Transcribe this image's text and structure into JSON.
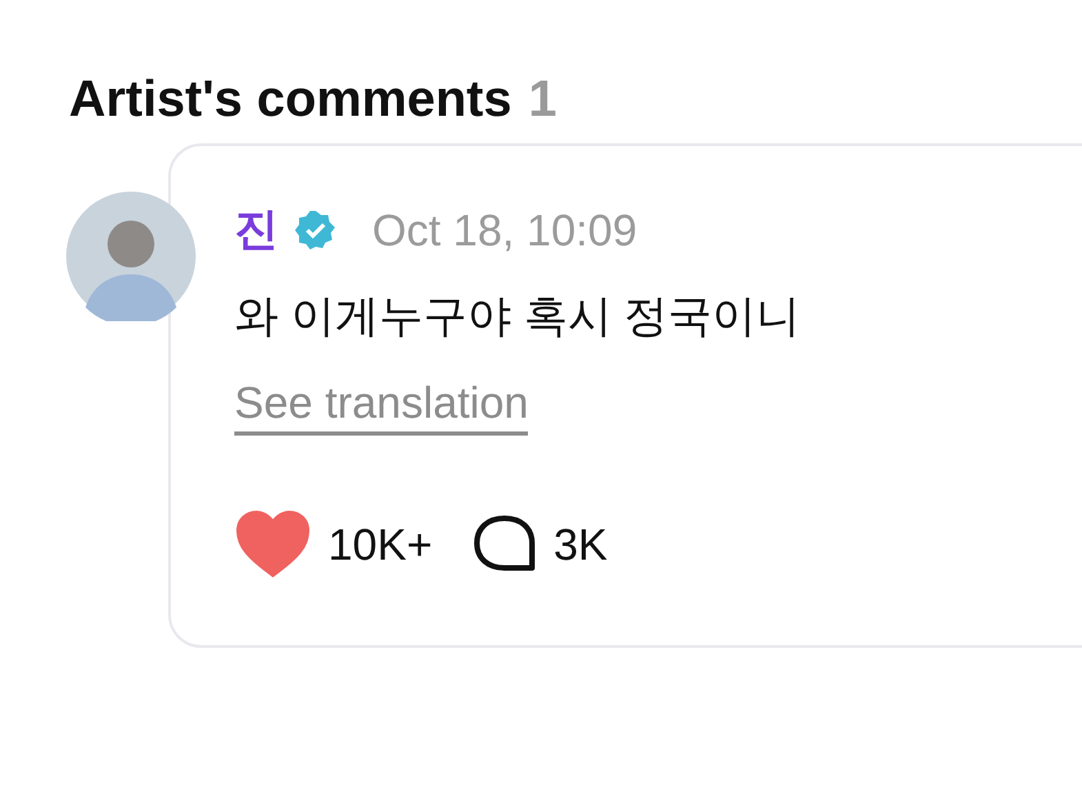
{
  "header": {
    "title": "Artist's comments",
    "count": "1"
  },
  "comment": {
    "author": "진",
    "verified": true,
    "time": "Oct 18, 10:09",
    "text": "와 이게누구야 혹시 정국이니",
    "translation_link": "See translation",
    "liked": true,
    "likes": "10K+",
    "replies": "3K"
  }
}
